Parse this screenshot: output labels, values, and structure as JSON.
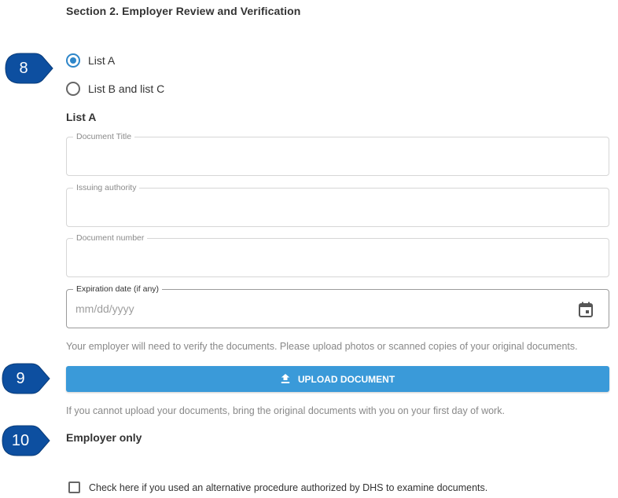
{
  "section": {
    "title": "Section 2. Employer Review and Verification"
  },
  "callouts": {
    "c8": "8",
    "c9": "9",
    "c10": "10"
  },
  "document_choice": {
    "options": [
      {
        "label": "List A",
        "selected": true
      },
      {
        "label": "List B and list C",
        "selected": false
      }
    ]
  },
  "list_a": {
    "heading": "List A",
    "fields": {
      "document_title": {
        "label": "Document Title",
        "value": "",
        "placeholder": ""
      },
      "issuing_authority": {
        "label": "Issuing authority",
        "value": "",
        "placeholder": ""
      },
      "document_number": {
        "label": "Document number",
        "value": "",
        "placeholder": ""
      },
      "expiration_date": {
        "label": "Expiration date (if any)",
        "value": "",
        "placeholder": "mm/dd/yyyy",
        "icon": "calendar-icon"
      }
    }
  },
  "upload": {
    "helper_text": "Your employer will need to verify the documents. Please upload photos or scanned copies of your original documents.",
    "button_label": "UPLOAD DOCUMENT",
    "button_icon": "upload-icon",
    "fallback_text": "If you cannot upload your documents, bring the original documents with you on your first day of work."
  },
  "employer_only": {
    "heading": "Employer only",
    "alt_procedure_label": "Check here if you used an alternative procedure authorized by DHS to examine documents.",
    "alt_procedure_checked": false
  },
  "colors": {
    "accent": "#3a9ad9",
    "radio": "#2e86c9",
    "callout": "#0d4fa0"
  }
}
